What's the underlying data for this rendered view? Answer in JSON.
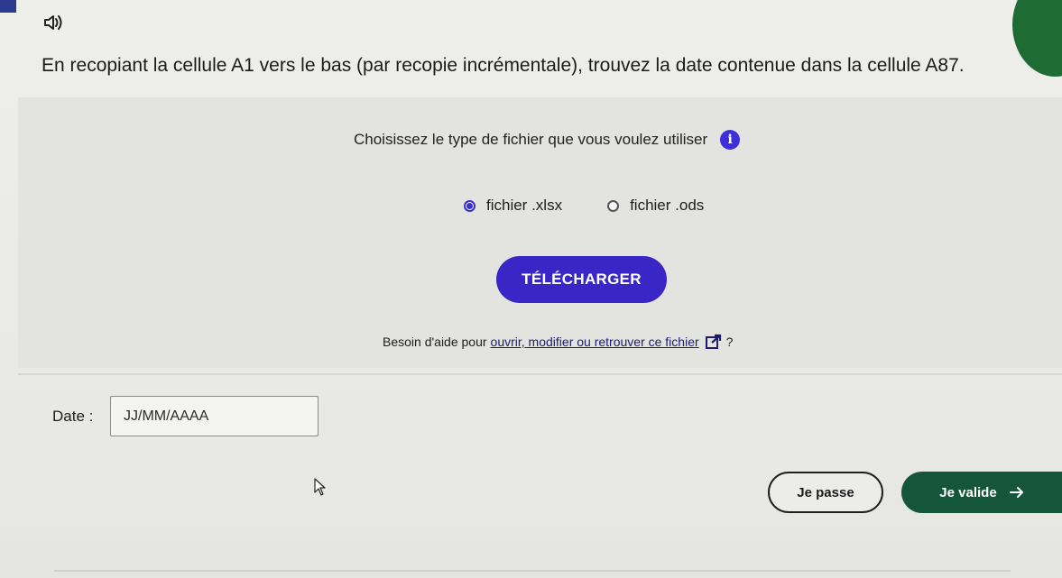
{
  "question": {
    "text": "En recopiant la cellule A1 vers le bas (par recopie incrémentale), trouvez la date contenue dans la cellule A87."
  },
  "file_choice": {
    "prompt": "Choisissez le type de fichier que vous voulez utiliser",
    "info_icon": "info-icon",
    "options": [
      {
        "label": "fichier .xlsx",
        "selected": true
      },
      {
        "label": "fichier .ods",
        "selected": false
      }
    ]
  },
  "download_button": {
    "label": "TÉLÉCHARGER"
  },
  "help": {
    "prefix": "Besoin d'aide pour",
    "link_text": "ouvrir, modifier ou retrouver ce fichier",
    "suffix": "?",
    "icon": "external-link-icon"
  },
  "answer": {
    "label": "Date :",
    "placeholder": "JJ/MM/AAAA",
    "value": ""
  },
  "actions": {
    "skip_label": "Je passe",
    "validate_label": "Je valide",
    "validate_icon": "arrow-right-icon"
  },
  "colors": {
    "primary": "#3a26c6",
    "validate": "#15553a",
    "accent_green": "#1f6b34"
  }
}
